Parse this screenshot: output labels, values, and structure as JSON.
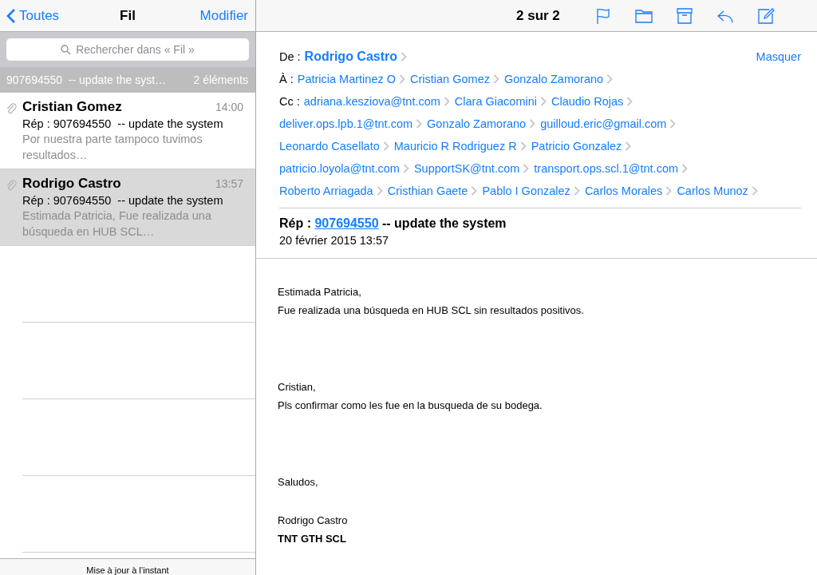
{
  "list_nav": {
    "back": "Toutes",
    "title": "Fil",
    "edit": "Modifier"
  },
  "search": {
    "placeholder": "Rechercher dans « Fil »"
  },
  "thread_header": {
    "subject": "907694550  -- update the syst…",
    "count": "2 éléments"
  },
  "messages": [
    {
      "sender": "Cristian Gomez",
      "time": "14:00",
      "subject": "Rép : 907694550  -- update the system",
      "preview": "Por nuestra parte tampoco tuvimos resultados…",
      "attachment": true,
      "selected": false
    },
    {
      "sender": "Rodrigo Castro",
      "time": "13:57",
      "subject": "Rép : 907694550  -- update the system",
      "preview": "Estimada Patricia, Fue realizada una búsqueda en HUB SCL…",
      "attachment": true,
      "selected": true
    }
  ],
  "list_status": "Mise à jour à l’instant",
  "toolbar": {
    "position": "2 sur 2"
  },
  "header": {
    "from_label": "De :",
    "from": "Rodrigo Castro",
    "hide": "Masquer",
    "to_label": "À :",
    "to": [
      "Patricia Martinez O",
      "Cristian Gomez",
      "Gonzalo Zamorano"
    ],
    "cc_label": "Cc :",
    "cc_lines": [
      [
        "adriana.kesziova@tnt.com",
        "Clara Giacomini",
        "Claudio Rojas"
      ],
      [
        "deliver.ops.lpb.1@tnt.com",
        "Gonzalo Zamorano",
        "guilloud.eric@gmail.com"
      ],
      [
        "Leonardo Casellato",
        "Mauricio R Rodriguez R",
        "Patricio Gonzalez"
      ],
      [
        "patricio.loyola@tnt.com",
        "SupportSK@tnt.com",
        "transport.ops.scl.1@tnt.com"
      ],
      [
        "Roberto Arriagada",
        "Cristhian Gaete",
        "Pablo I Gonzalez",
        "Carlos Morales",
        "Carlos Munoz"
      ]
    ]
  },
  "subject": {
    "prefix": "Rép :",
    "link": "907694550",
    "suffix": "-- update the system"
  },
  "date": "20 février 2015 13:57",
  "body": [
    {
      "lines": [
        {
          "text": "Estimada Patricia,",
          "bold": false
        },
        {
          "text": "Fue realizada una búsqueda en HUB SCL sin resultados positivos.",
          "bold": false
        }
      ]
    },
    {
      "lines": [
        {
          "text": "Cristian,",
          "bold": false
        },
        {
          "text": "Pls confirmar como les fue en la busqueda de su bodega.",
          "bold": false
        }
      ]
    },
    {
      "lines": [
        {
          "text": "Saludos,",
          "bold": false
        }
      ]
    },
    {
      "lines": [
        {
          "text": "Rodrigo Castro",
          "bold": false
        },
        {
          "text": "TNT GTH SCL",
          "bold": true
        }
      ]
    }
  ]
}
